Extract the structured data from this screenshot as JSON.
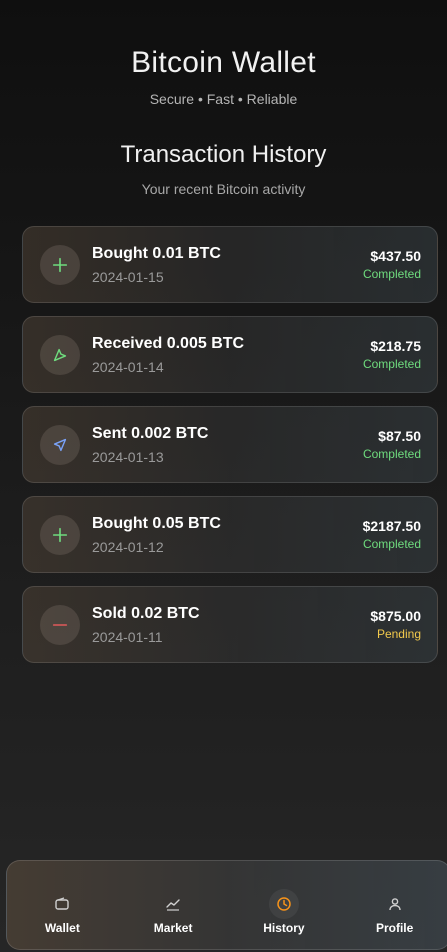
{
  "header": {
    "title": "Bitcoin Wallet",
    "subtitle": "Secure • Fast • Reliable"
  },
  "section": {
    "title": "Transaction History",
    "subtitle": "Your recent Bitcoin activity"
  },
  "transactions": [
    {
      "title": "Bought 0.01 BTC",
      "date": "2024-01-15",
      "amount": "$437.50",
      "status": "Completed",
      "icon": "plus-icon"
    },
    {
      "title": "Received 0.005 BTC",
      "date": "2024-01-14",
      "amount": "$218.75",
      "status": "Completed",
      "icon": "receive-arrow-icon"
    },
    {
      "title": "Sent 0.002 BTC",
      "date": "2024-01-13",
      "amount": "$87.50",
      "status": "Completed",
      "icon": "send-arrow-icon"
    },
    {
      "title": "Bought 0.05 BTC",
      "date": "2024-01-12",
      "amount": "$2187.50",
      "status": "Completed",
      "icon": "plus-icon"
    },
    {
      "title": "Sold 0.02 BTC",
      "date": "2024-01-11",
      "amount": "$875.00",
      "status": "Pending",
      "icon": "minus-icon"
    }
  ],
  "nav": {
    "items": [
      {
        "label": "Wallet",
        "icon": "wallet-icon"
      },
      {
        "label": "Market",
        "icon": "chart-icon"
      },
      {
        "label": "History",
        "icon": "clock-icon",
        "active": true
      },
      {
        "label": "Profile",
        "icon": "user-icon"
      }
    ]
  },
  "colors": {
    "completed": "#6fdc7e",
    "pending": "#f2c94c",
    "accent": "#f7931a",
    "send": "#7aa2f7"
  }
}
